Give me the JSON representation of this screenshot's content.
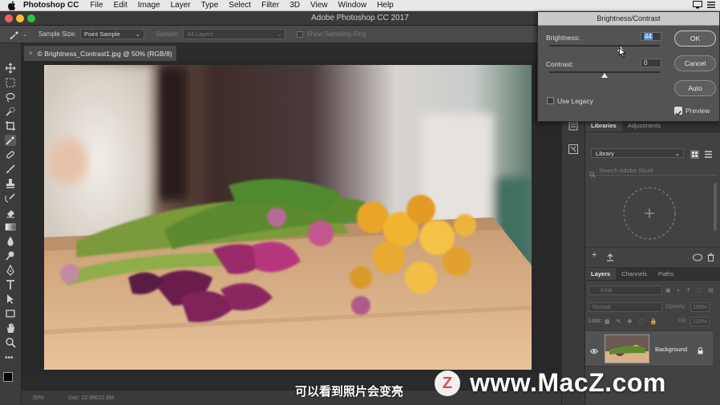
{
  "menubar": {
    "app_name": "Photoshop CC",
    "items": [
      "File",
      "Edit",
      "Image",
      "Layer",
      "Type",
      "Select",
      "Filter",
      "3D",
      "View",
      "Window",
      "Help"
    ]
  },
  "window": {
    "title": "Adobe Photoshop CC 2017"
  },
  "options": {
    "sample_size_label": "Sample Size:",
    "sample_size_value": "Point Sample",
    "sample_label": "Sample:",
    "sample_value": "All Layers",
    "show_ring_label": "Show Sampling Ring"
  },
  "document": {
    "tab_label": "© Brightness_Contrast1.jpg @ 50% (RGB/8)",
    "close_glyph": "×"
  },
  "status": {
    "zoom": "50%",
    "doc_size": "Doc: 22.8M/22.8M"
  },
  "dialog": {
    "title": "Brightness/Contrast",
    "brightness_label": "Brightness:",
    "brightness_value": "44",
    "contrast_label": "Contrast:",
    "contrast_value": "0",
    "use_legacy_label": "Use Legacy",
    "preview_label": "Preview",
    "ok_label": "OK",
    "cancel_label": "Cancel",
    "auto_label": "Auto",
    "brightness_level": 44,
    "contrast_level": 0
  },
  "libraries_panel": {
    "tabs": [
      "Libraries",
      "Adjustments"
    ],
    "library_select": "Library",
    "search_placeholder": "Search Adobe Stock"
  },
  "layers_panel": {
    "tabs": [
      "Layers",
      "Channels",
      "Paths"
    ],
    "kind_label": "Kind",
    "blend_mode": "Normal",
    "opacity_label": "Opacity:",
    "opacity_value": "100%",
    "lock_label": "Lock:",
    "fill_label": "Fill:",
    "fill_value": "100%",
    "layer_name": "Background"
  },
  "subtitle": {
    "text": "可以看到照片会变亮"
  },
  "watermark": {
    "text": "www.MacZ.com",
    "logo_letter": "Z"
  },
  "colors": {
    "ui_dark": "#3c3c3c",
    "dialog_bg": "#535353",
    "highlight": "#4a8fd8"
  }
}
